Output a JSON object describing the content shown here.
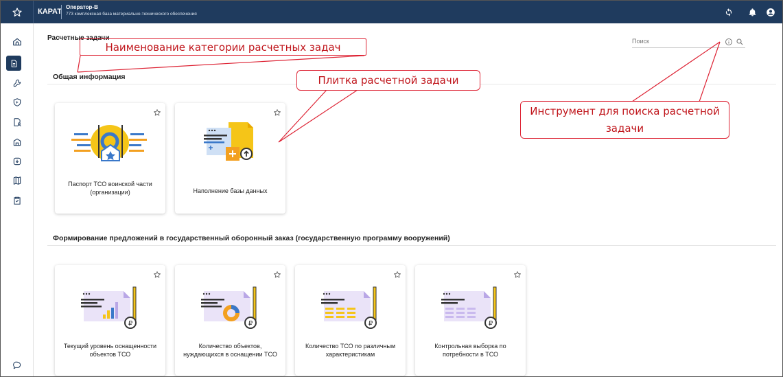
{
  "topbar": {
    "brand": "КАРАТ",
    "org_title": "Оператор-В",
    "org_subtitle": "773 комплексная база материально-технического обеспечения"
  },
  "page": {
    "title": "Расчетные задачи"
  },
  "search": {
    "placeholder": "Поиск"
  },
  "categories": [
    {
      "title": "Общая информация"
    },
    {
      "title": "Формирование предложений в государственный оборонный заказ (государственную программу вооружений)"
    }
  ],
  "tiles": [
    {
      "label": "Паспорт ТСО воинской части (организации)"
    },
    {
      "label": "Наполнение базы данных"
    },
    {
      "label": "Текущий уровень оснащенности объектов ТСО"
    },
    {
      "label": "Количество объектов, нуждающихся в оснащении ТСО"
    },
    {
      "label": "Количество ТСО по различным характеристикам"
    },
    {
      "label": "Контрольная выборка по потребности в ТСО"
    }
  ],
  "annotations": {
    "category_name": "Наименование категории расчетных задач",
    "tile": "Плитка расчетной задачи",
    "search_tool": "Инструмент для поиска расчетной задачи"
  },
  "colors": {
    "topbar": "#1f3b5e",
    "annotation": "#c0151b",
    "accent_yellow": "#f5c518",
    "accent_blue": "#3a78c9",
    "accent_purple": "#b9a7e6"
  }
}
